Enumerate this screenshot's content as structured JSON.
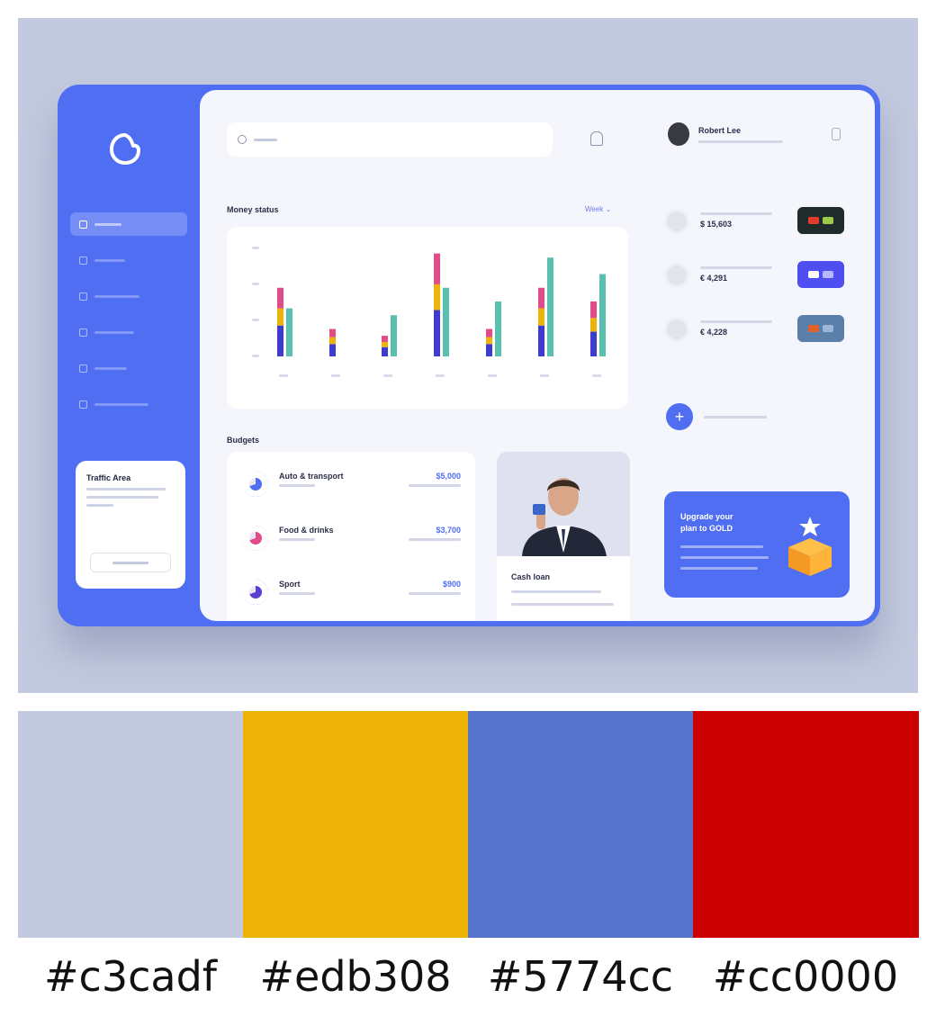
{
  "preview": {
    "search": {
      "icon": "search-icon"
    },
    "header": {
      "bell_icon": "bell-icon"
    },
    "sidebar": {
      "logo_icon": "logo-icon",
      "items": [
        {
          "icon": "home-icon",
          "active": true
        },
        {
          "icon": "wallet-icon",
          "active": false
        },
        {
          "icon": "chart-icon",
          "active": false
        },
        {
          "icon": "transfer-icon",
          "active": false
        },
        {
          "icon": "user-icon",
          "active": false
        },
        {
          "icon": "settings-icon",
          "active": false
        }
      ],
      "promo": {
        "title": "Traffic Area"
      }
    },
    "money_status": {
      "title": "Money status",
      "period_label": "Week ⌄",
      "chart_data": {
        "type": "bar",
        "categories": [
          "",
          "",
          "",
          "",
          "",
          "",
          ""
        ],
        "series": [
          {
            "values": [
              50,
              20,
              15,
              75,
              20,
              50,
              40
            ],
            "colors": [
              "#3f3bd1",
              "#edb308",
              "#e24c8a"
            ]
          },
          {
            "values": [
              35,
              0,
              30,
              50,
              40,
              72,
              60
            ],
            "colors": [
              "#5bbfb0"
            ]
          }
        ],
        "ylim": [
          0,
          80
        ],
        "grid": false
      }
    },
    "budgets": {
      "title": "Budgets",
      "items": [
        {
          "name": "Auto & transport",
          "amount": "$5,000",
          "ring_color": "#4f6ef2"
        },
        {
          "name": "Food & drinks",
          "amount": "$3,700",
          "ring_color": "#e24c8a"
        },
        {
          "name": "Sport",
          "amount": "$900",
          "ring_color": "#5b3fd1"
        }
      ]
    },
    "loan": {
      "title": "Cash loan"
    },
    "profile": {
      "name": "Robert Lee"
    },
    "accounts": [
      {
        "amount": "$ 15,603",
        "card_color": "#1f2a2a"
      },
      {
        "amount": "€ 4,291",
        "card_color": "#4f4ef0"
      },
      {
        "amount": "€ 4,228",
        "card_color": "#5a7fa8"
      }
    ],
    "upgrade": {
      "title_line1": "Upgrade your",
      "title_line2": "plan to GOLD"
    }
  },
  "palette": [
    {
      "hex": "#c3cadf",
      "label": "#c3cadf"
    },
    {
      "hex": "#edb308",
      "label": "#edb308"
    },
    {
      "hex": "#5774cc",
      "label": "#5774cc"
    },
    {
      "hex": "#cc0000",
      "label": "#cc0000"
    }
  ]
}
